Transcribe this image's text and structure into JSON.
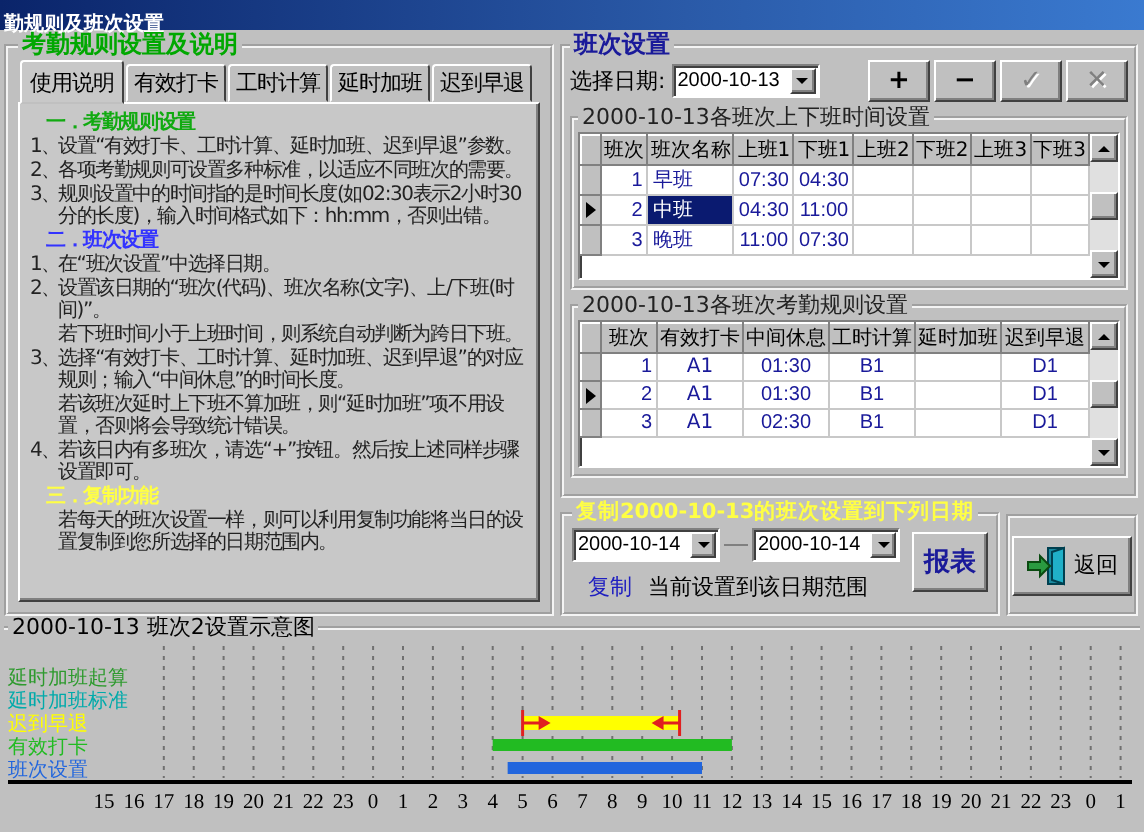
{
  "window": {
    "title": "勤规则及班次设置"
  },
  "rules_panel": {
    "title": "考勤规则设置及说明",
    "tabs": [
      {
        "label": "使用说明",
        "selected": true
      },
      {
        "label": "有效打卡",
        "selected": false
      },
      {
        "label": "工时计算",
        "selected": false
      },
      {
        "label": "延时加班",
        "selected": false
      },
      {
        "label": "迟到早退",
        "selected": false
      }
    ],
    "sections": [
      {
        "heading": "一．考勤规则设置",
        "color": "#11aa11",
        "items": [
          {
            "number": "1、",
            "text": "设置“有效打卡、工时计算、延时加班、迟到早退”参数。"
          },
          {
            "number": "2、",
            "text": "各项考勤规则可设置多种标准，以适应不同班次的需要。"
          },
          {
            "number": "3、",
            "text": "规则设置中的时间指的是时间长度(如02:30表示2小时30分的长度)，输入时间格式如下：hh:mm，否则出错。"
          }
        ]
      },
      {
        "heading": "二．班次设置",
        "color": "#3333ff",
        "items": [
          {
            "number": "1、",
            "text": "在“班次设置”中选择日期。"
          },
          {
            "number": "2、",
            "text": "设置该日期的“班次(代码)、班次名称(文字)、上/下班(时间)”。",
            "notes": [
              "若下班时间小于上班时间，则系统自动判断为跨日下班。"
            ]
          },
          {
            "number": "3、",
            "text": "选择“有效打卡、工时计算、延时加班、迟到早退”的对应规则；输入“中间休息”的时间长度。",
            "notes": [
              "若该班次延时上下班不算加班，则“延时加班”项不用设置，否则将会导致统计错误。"
            ]
          },
          {
            "number": "4、",
            "text": "若该日内有多班次，请选“+”按钮。然后按上述同样步骤设置即可。"
          }
        ]
      },
      {
        "heading": "三．复制功能",
        "color": "#ffff44",
        "items": [
          {
            "text": "若每天的班次设置一样，则可以利用复制功能将当日的设置复制到您所选择的日期范围内。"
          }
        ]
      }
    ]
  },
  "shift_panel": {
    "title": "班次设置",
    "date_label": "选择日期:",
    "date": "2000-10-13",
    "buttons": [
      {
        "label": "+",
        "disabled": false
      },
      {
        "label": "−",
        "disabled": false
      },
      {
        "label": "✓",
        "disabled": true
      },
      {
        "label": "✕",
        "disabled": true
      }
    ],
    "times_grid": {
      "caption": "2000-10-13各班次上下班时间设置",
      "columns": [
        "班次",
        "班次名称",
        "上班1",
        "下班1",
        "上班2",
        "下班2",
        "上班3",
        "下班3"
      ],
      "rows": [
        {
          "shift": "1",
          "name": "早班",
          "on_1": "07:30",
          "off_1": "04:30",
          "selected": false
        },
        {
          "shift": "2",
          "name": "中班",
          "on_1": "04:30",
          "off_1": "11:00",
          "selected": true
        },
        {
          "shift": "3",
          "name": "晚班",
          "on_1": "11:00",
          "off_1": "07:30",
          "selected": false
        }
      ]
    },
    "rules_grid": {
      "caption": "2000-10-13各班次考勤规则设置",
      "columns": [
        "班次",
        "有效打卡",
        "中间休息",
        "工时计算",
        "延时加班",
        "迟到早退"
      ],
      "rows": [
        {
          "shift": "1",
          "punch": "A1",
          "break": "01:30",
          "work_hours": "B1",
          "late_early": "D1",
          "selected": false
        },
        {
          "shift": "2",
          "punch": "A1",
          "break": "01:30",
          "work_hours": "B1",
          "late_early": "D1",
          "selected": true
        },
        {
          "shift": "3",
          "punch": "A1",
          "break": "02:30",
          "work_hours": "B1",
          "late_early": "D1",
          "selected": false
        }
      ]
    }
  },
  "copy_panel": {
    "title": "复制2000-10-13的班次设置到下列日期",
    "from_date": "2000-10-14",
    "to_date": "2000-10-14",
    "copy_link": "复制",
    "description": "当前设置到该日期范围",
    "report_button": "报表",
    "back_button": "返回"
  },
  "schedule_chart": {
    "title": "2000-10-13 班次2设置示意图",
    "rows": [
      {
        "label": "延时加班起算",
        "color": "#2e9a2e",
        "kind": "label"
      },
      {
        "label": "延时加班标准",
        "color": "#00aaaa",
        "kind": "label"
      },
      {
        "label": "迟到早退",
        "color": "#ffff00",
        "kind": "range"
      },
      {
        "label": "有效打卡",
        "color": "#22bb22",
        "kind": "bar"
      },
      {
        "label": "班次设置",
        "color": "#2266dd",
        "kind": "bar"
      }
    ],
    "ticks": [
      "15",
      "16",
      "17",
      "18",
      "19",
      "20",
      "21",
      "22",
      "23",
      "0",
      "1",
      "2",
      "3",
      "4",
      "5",
      "6",
      "7",
      "8",
      "9",
      "10",
      "11",
      "12",
      "13",
      "14",
      "15",
      "16",
      "17",
      "18",
      "19",
      "20",
      "21",
      "22",
      "23",
      "0",
      "1"
    ]
  }
}
